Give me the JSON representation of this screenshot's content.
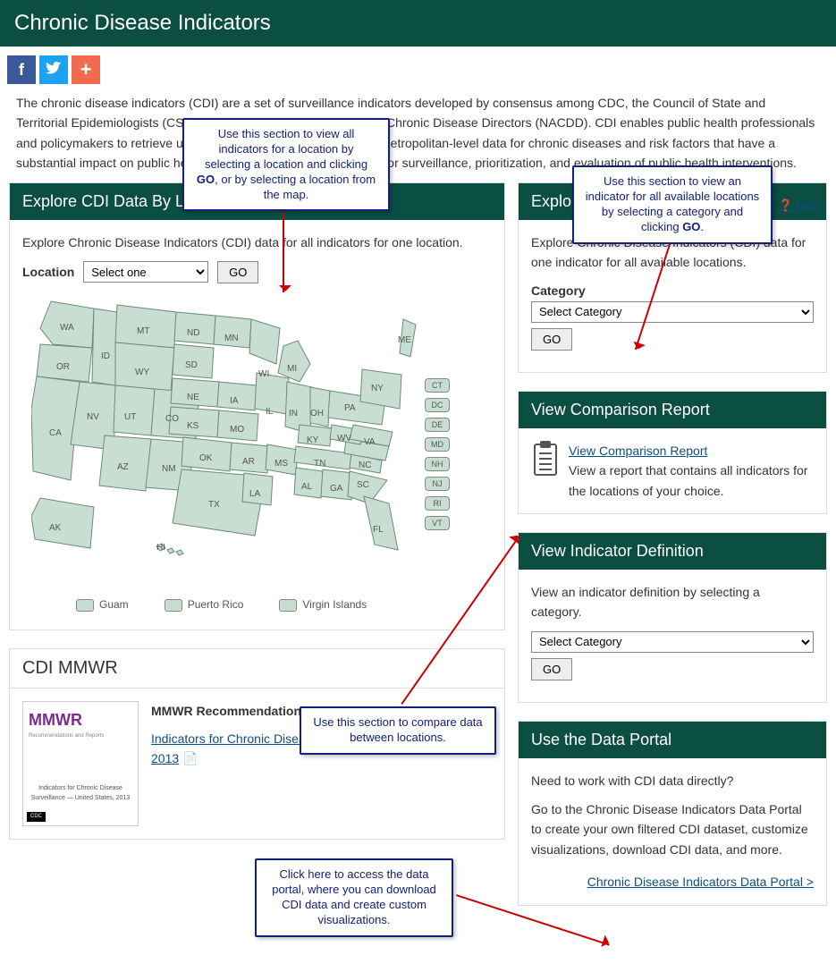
{
  "header": {
    "title": "Chronic Disease Indicators"
  },
  "social": {
    "facebook": "f",
    "twitter": "t",
    "addthis": "+"
  },
  "intro": {
    "text": "The chronic disease indicators (CDI) are a set of surveillance indicators developed by consensus among CDC, the Council of State and Territorial Epidemiologists (CSTE), and the National Association of Chronic Disease Directors (NACDD). CDI enables public health professionals and policymakers to retrieve uniformly defined state and selected metropolitan-level data for chronic diseases and risk factors that have a substantial impact on public health. These indicators are essential for surveillance, prioritization, and evaluation of public health interventions.",
    "help": "Help"
  },
  "callouts": {
    "loc": "Use this section to view all indicators for a location by selecting a location and clicking GO, or by selecting a location from the map.",
    "ind": "Use this section to view an indicator for all available locations by selecting a category and clicking GO.",
    "cmp": "Use this section to compare data between locations.",
    "portal": "Click here to access the data portal, where you can download CDI data and create custom visualizations."
  },
  "byLocation": {
    "title": "Explore CDI Data By Location",
    "desc": "Explore Chronic Disease Indicators (CDI) data for all indicators for one location.",
    "label": "Location",
    "placeholder": "Select one",
    "go": "GO",
    "territories": {
      "guam": "Guam",
      "pr": "Puerto Rico",
      "vi": "Virgin Islands"
    },
    "pills": [
      "CT",
      "DC",
      "DE",
      "MD",
      "NH",
      "NJ",
      "RI",
      "VT"
    ],
    "states": [
      "WA",
      "OR",
      "CA",
      "NV",
      "ID",
      "MT",
      "WY",
      "UT",
      "AZ",
      "NM",
      "CO",
      "ND",
      "SD",
      "NE",
      "KS",
      "OK",
      "TX",
      "MN",
      "IA",
      "MO",
      "AR",
      "LA",
      "WI",
      "IL",
      "MS",
      "MI",
      "IN",
      "OH",
      "KY",
      "TN",
      "AL",
      "GA",
      "FL",
      "SC",
      "NC",
      "WV",
      "VA",
      "PA",
      "NY",
      "ME",
      "AK",
      "HI"
    ]
  },
  "byIndicator": {
    "title": "Explore CDI Data by Indicator",
    "desc": "Explore Chronic Disease Indicators (CDI) data for one indicator for all available locations.",
    "label": "Category",
    "placeholder": "Select Category",
    "go": "GO"
  },
  "comparison": {
    "title": "View Comparison Report",
    "link": "View Comparison Report",
    "desc": "View a report that contains all indicators for the locations of your choice."
  },
  "definition": {
    "title": "View Indicator Definition",
    "desc": "View an indicator definition by selecting a category.",
    "placeholder": "Select Category",
    "go": "GO"
  },
  "portal": {
    "title": "Use the Data Portal",
    "q": "Need to work with CDI data directly?",
    "desc": "Go to the Chronic Disease Indicators Data Portal to create your own filtered CDI dataset, customize visualizations, download CDI data, and more.",
    "link": "Chronic Disease Indicators Data Portal >"
  },
  "mmwr": {
    "title": "CDI MMWR",
    "heading": "MMWR Recommendations & Reports",
    "link": "Indicators for Chronic Disease Surveillance - United States, 2013",
    "thumb_title": "Indicators for Chronic Disease Surveillance — United States, 2013"
  }
}
